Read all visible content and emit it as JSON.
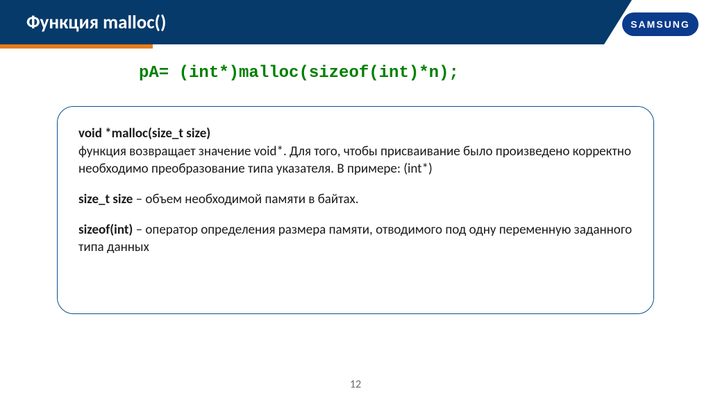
{
  "header": {
    "title": "Функция malloc()"
  },
  "logo": {
    "text": "SAMSUNG"
  },
  "code": {
    "line": "pA= (int*)malloc(sizeof(int)*n);"
  },
  "box": {
    "p1": {
      "bold": "void *malloc(size_t size)",
      "rest": "функция возвращает значение void*. Для того, чтобы присваивание было произведено корректно необходимо преобразование типа указателя. В примере: (int*)"
    },
    "p2": {
      "bold": "size_t size",
      "rest": " – объем необходимой памяти в байтах."
    },
    "p3": {
      "bold": "sizeof(int)",
      "rest": " – оператор определения размера памяти, отводимого под одну переменную заданного типа данных"
    }
  },
  "page": {
    "number": "12"
  }
}
